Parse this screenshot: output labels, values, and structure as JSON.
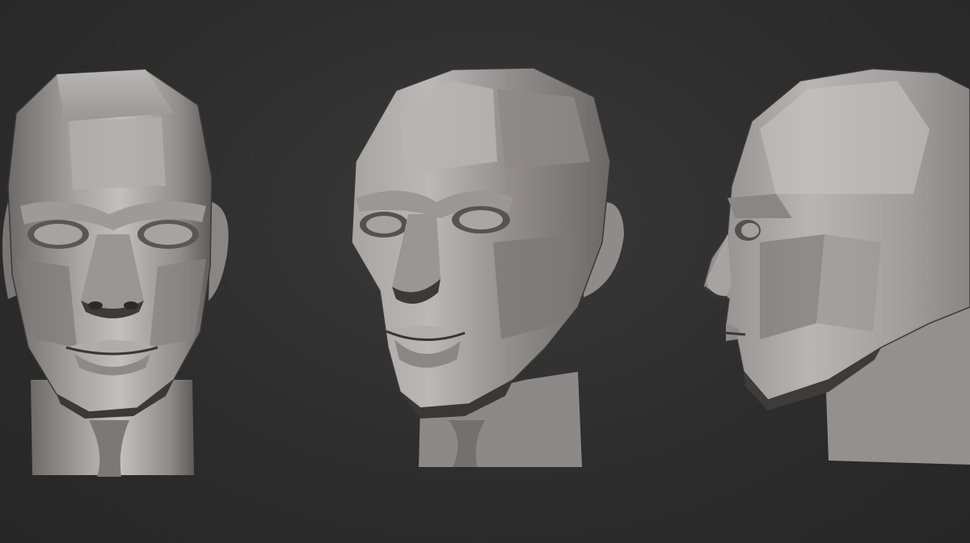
{
  "scene": {
    "background_color": "#2e2e2e",
    "material_color": "#8e8a8a",
    "highlight_color": "#d4d0d0",
    "shadow_color": "#4a4646",
    "views": [
      {
        "name": "front-view",
        "icon": "head-front"
      },
      {
        "name": "three-quarter-view",
        "icon": "head-three-quarter"
      },
      {
        "name": "profile-view",
        "icon": "head-profile"
      }
    ]
  }
}
